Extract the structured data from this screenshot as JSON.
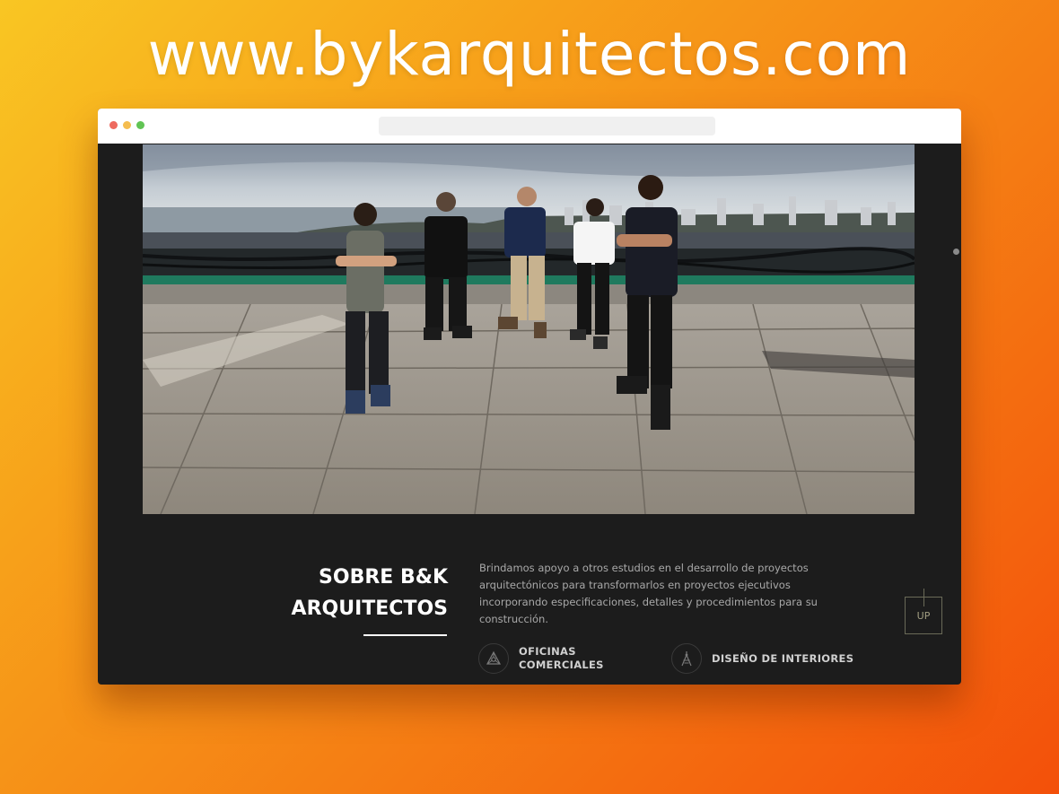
{
  "banner": {
    "url_text": "www.bykarquitectos.com"
  },
  "about": {
    "title_line1": "SOBRE B&K",
    "title_line2": "ARQUITECTOS",
    "description": "Brindamos apoyo a otros estudios en el desarrollo de proyectos arquitectónicos para transformarlos en proyectos ejecutivos incorporando especificaciones, detalles y procedimientos para su construcción."
  },
  "services": [
    {
      "label": "OFICINAS COMERCIALES",
      "icon": "office-icon"
    },
    {
      "label": "DISEÑO DE INTERIORES",
      "icon": "interior-design-icon"
    }
  ],
  "up_button": {
    "label": "UP"
  },
  "colors": {
    "page_bg": "#1c1c1c",
    "accent_up": "#a39f83",
    "gradient_start": "#f9c623",
    "gradient_end": "#f3500a"
  }
}
